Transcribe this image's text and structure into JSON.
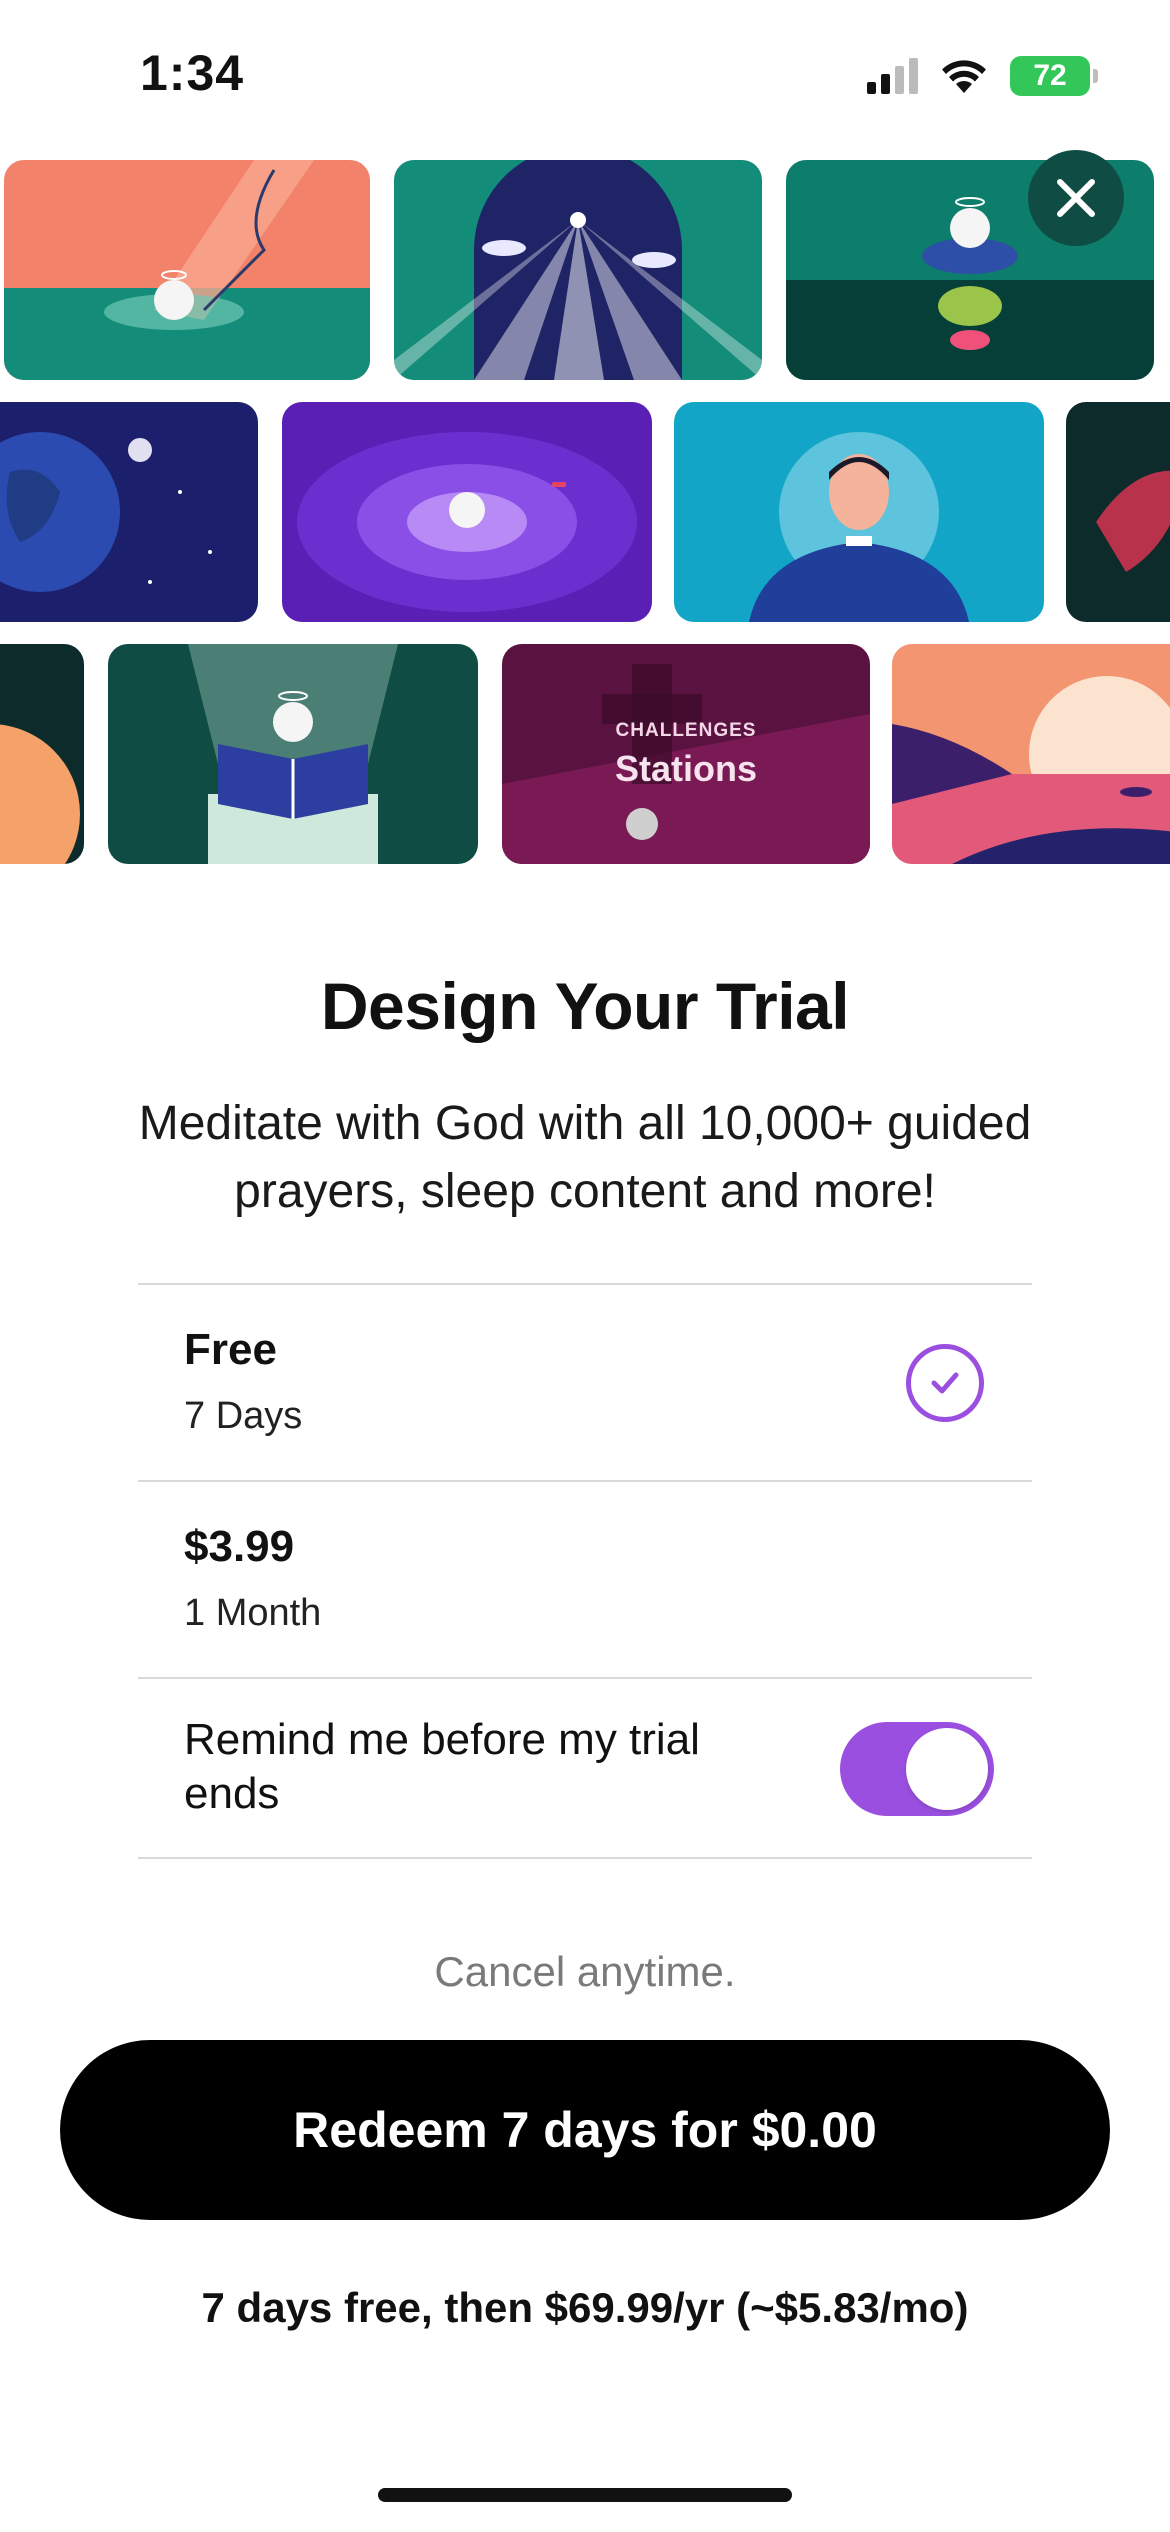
{
  "status_bar": {
    "time": "1:34",
    "battery": "72",
    "icons": [
      "signal-icon",
      "wifi-icon",
      "battery-icon"
    ]
  },
  "gallery": {
    "close_icon": "close-icon",
    "featured_tile": {
      "category": "CHALLENGES",
      "name": "Stations"
    }
  },
  "trial": {
    "title": "Design Your Trial",
    "subtitle": "Meditate with God with all 10,000+ guided prayers, sleep content and more!",
    "options": [
      {
        "price": "Free",
        "duration": "7 Days",
        "selected": true
      },
      {
        "price": "$3.99",
        "duration": "1 Month",
        "selected": false
      }
    ],
    "reminder": {
      "label": "Remind me before my trial ends",
      "enabled": true
    },
    "cancel_note": "Cancel anytime.",
    "cta_label": "Redeem 7 days for $0.00",
    "fine_print": "7 days free, then $69.99/yr (~$5.83/mo)"
  },
  "colors": {
    "accent": "#9b4fe0",
    "cta": "#000000",
    "close_button": "#0f4d44",
    "battery": "#33c759"
  }
}
